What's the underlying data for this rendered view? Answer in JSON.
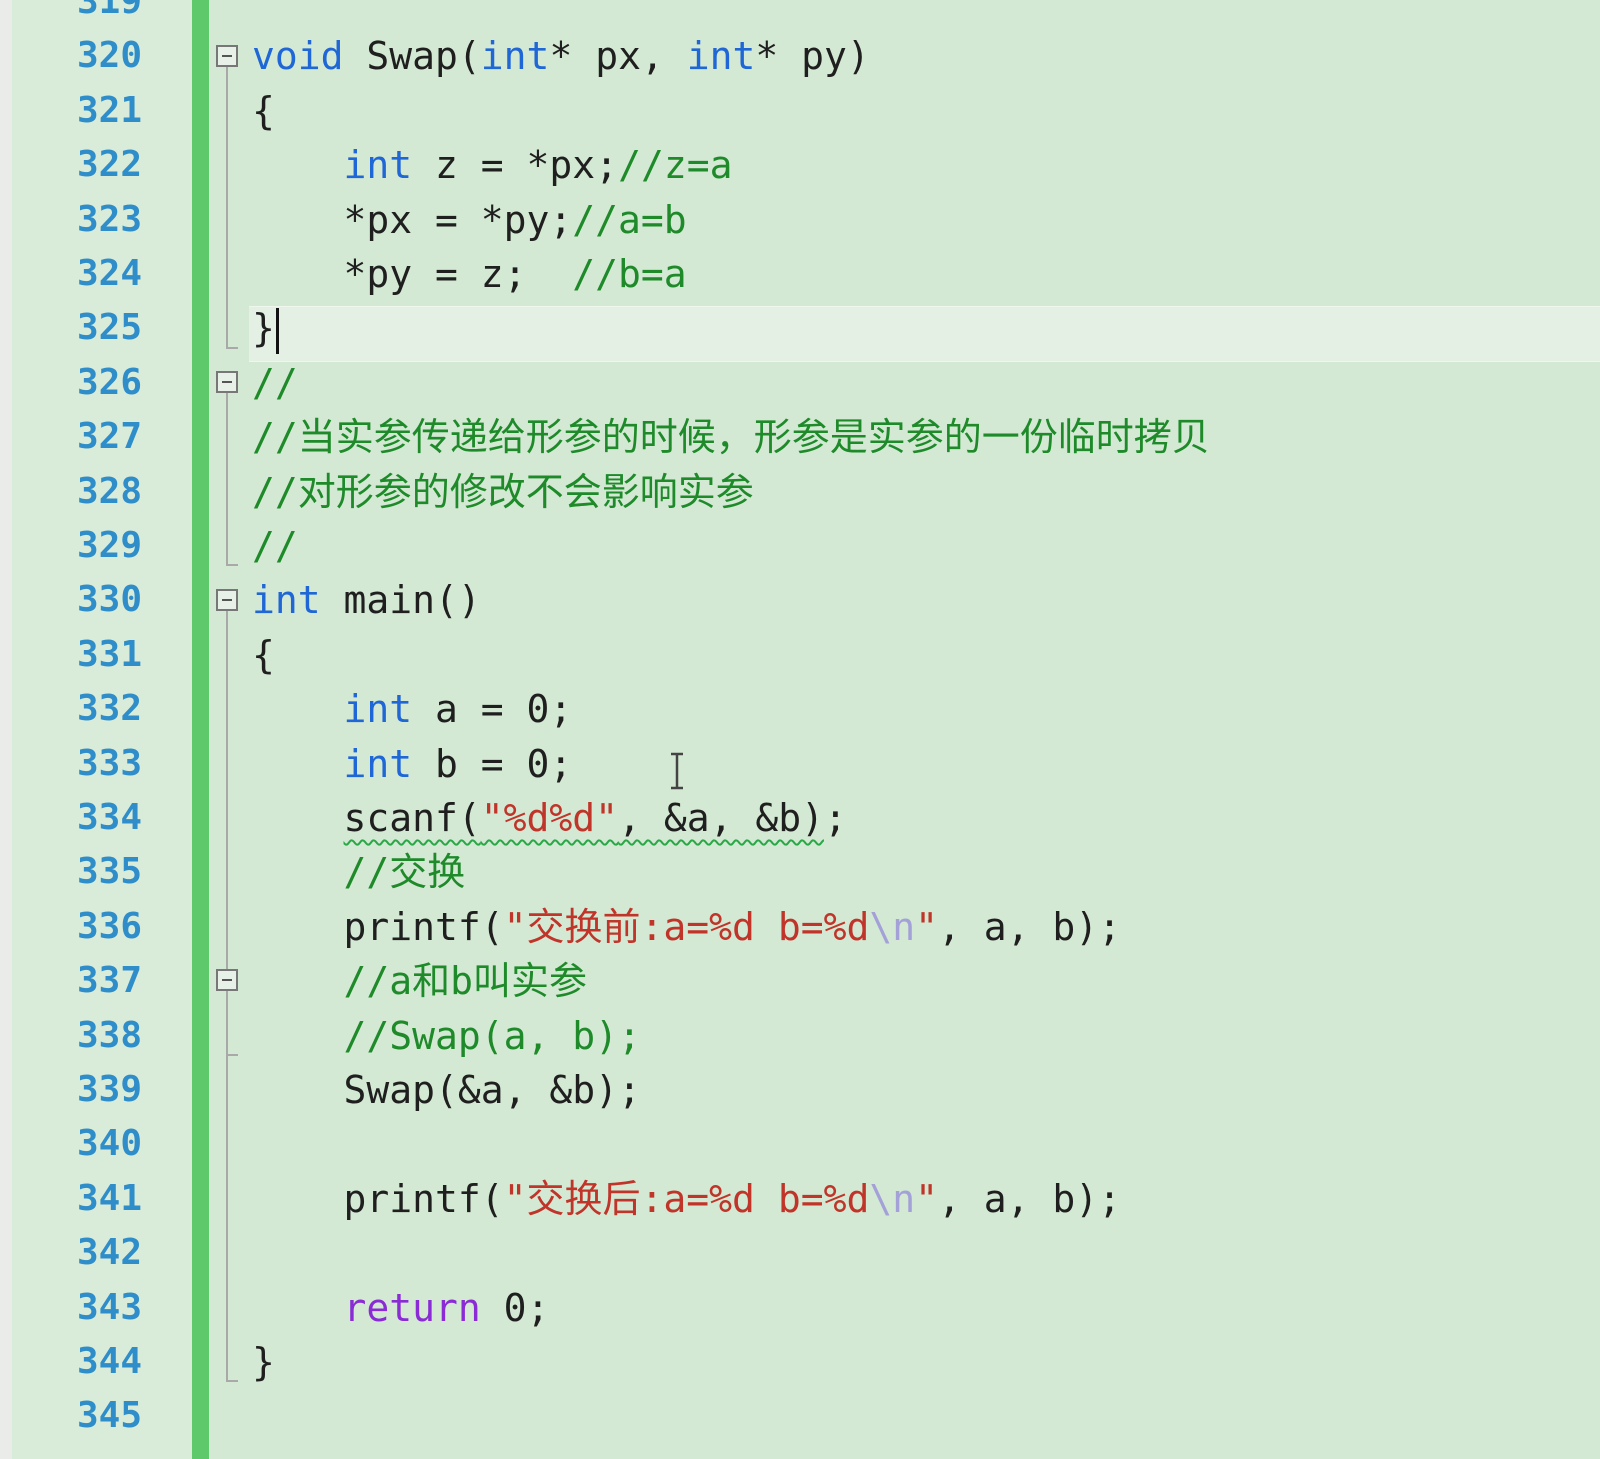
{
  "editor": {
    "current_line": 325,
    "lines": [
      {
        "n": "319",
        "segs": []
      },
      {
        "n": "320",
        "segs": [
          {
            "t": "void",
            "c": "kw"
          },
          {
            "t": " Swap(",
            "c": ""
          },
          {
            "t": "int",
            "c": "kw"
          },
          {
            "t": "* px, ",
            "c": ""
          },
          {
            "t": "int",
            "c": "kw"
          },
          {
            "t": "* py)",
            "c": ""
          }
        ]
      },
      {
        "n": "321",
        "segs": [
          {
            "t": "{",
            "c": ""
          }
        ]
      },
      {
        "n": "322",
        "segs": [
          {
            "t": "    ",
            "c": ""
          },
          {
            "t": "int",
            "c": "kw"
          },
          {
            "t": " z = *px;",
            "c": ""
          },
          {
            "t": "//z=a",
            "c": "cm"
          }
        ]
      },
      {
        "n": "323",
        "segs": [
          {
            "t": "    *px = *py;",
            "c": ""
          },
          {
            "t": "//a=b",
            "c": "cm"
          }
        ]
      },
      {
        "n": "324",
        "segs": [
          {
            "t": "    *py = z;  ",
            "c": ""
          },
          {
            "t": "//b=a",
            "c": "cm"
          }
        ]
      },
      {
        "n": "325",
        "segs": [
          {
            "t": "}",
            "c": ""
          }
        ],
        "caret": true
      },
      {
        "n": "326",
        "segs": [
          {
            "t": "//",
            "c": "cm"
          }
        ]
      },
      {
        "n": "327",
        "segs": [
          {
            "t": "//当实参传递给形参的时候，形参是实参的一份临时拷贝",
            "c": "cm"
          }
        ]
      },
      {
        "n": "328",
        "segs": [
          {
            "t": "//对形参的修改不会影响实参",
            "c": "cm"
          }
        ]
      },
      {
        "n": "329",
        "segs": [
          {
            "t": "//",
            "c": "cm"
          }
        ]
      },
      {
        "n": "330",
        "segs": [
          {
            "t": "int",
            "c": "kw"
          },
          {
            "t": " main()",
            "c": ""
          }
        ]
      },
      {
        "n": "331",
        "segs": [
          {
            "t": "{",
            "c": ""
          }
        ]
      },
      {
        "n": "332",
        "segs": [
          {
            "t": "    ",
            "c": ""
          },
          {
            "t": "int",
            "c": "kw"
          },
          {
            "t": " a = 0;",
            "c": ""
          }
        ]
      },
      {
        "n": "333",
        "segs": [
          {
            "t": "    ",
            "c": ""
          },
          {
            "t": "int",
            "c": "kw"
          },
          {
            "t": " b = 0;",
            "c": ""
          }
        ]
      },
      {
        "n": "334",
        "segs": [
          {
            "t": "    ",
            "c": ""
          },
          {
            "t": "scanf(",
            "c": "squiggle"
          },
          {
            "t": "\"%d%d\"",
            "c": "st squiggle"
          },
          {
            "t": ", &a, &b)",
            "c": "squiggle"
          },
          {
            "t": ";",
            "c": ""
          }
        ]
      },
      {
        "n": "335",
        "segs": [
          {
            "t": "    ",
            "c": ""
          },
          {
            "t": "//交换",
            "c": "cm"
          }
        ]
      },
      {
        "n": "336",
        "segs": [
          {
            "t": "    printf(",
            "c": ""
          },
          {
            "t": "\"交换前:a=%d b=%d",
            "c": "st"
          },
          {
            "t": "\\n",
            "c": "esc"
          },
          {
            "t": "\"",
            "c": "st"
          },
          {
            "t": ", a, b);",
            "c": ""
          }
        ]
      },
      {
        "n": "337",
        "segs": [
          {
            "t": "    ",
            "c": ""
          },
          {
            "t": "//a和b叫实参",
            "c": "cm"
          }
        ]
      },
      {
        "n": "338",
        "segs": [
          {
            "t": "    ",
            "c": ""
          },
          {
            "t": "//Swap(a, b);",
            "c": "cm"
          }
        ]
      },
      {
        "n": "339",
        "segs": [
          {
            "t": "    Swap(&a, &b);",
            "c": ""
          }
        ]
      },
      {
        "n": "340",
        "segs": []
      },
      {
        "n": "341",
        "segs": [
          {
            "t": "    printf(",
            "c": ""
          },
          {
            "t": "\"交换后:a=%d b=%d",
            "c": "st"
          },
          {
            "t": "\\n",
            "c": "esc"
          },
          {
            "t": "\"",
            "c": "st"
          },
          {
            "t": ", a, b);",
            "c": ""
          }
        ]
      },
      {
        "n": "342",
        "segs": []
      },
      {
        "n": "343",
        "segs": [
          {
            "t": "    ",
            "c": ""
          },
          {
            "t": "return",
            "c": "kw2"
          },
          {
            "t": " 0;",
            "c": ""
          }
        ]
      },
      {
        "n": "344",
        "segs": [
          {
            "t": "}",
            "c": ""
          }
        ]
      },
      {
        "n": "345",
        "segs": []
      }
    ]
  },
  "theme": {
    "background": "#d3e9d3",
    "line_number_color": "#2f8ec9",
    "change_bar_color": "#5ec96a",
    "keyword_color": "#1f66d6",
    "return_keyword_color": "#8a2bd6",
    "comment_color": "#1e8a2a",
    "string_color": "#c0342a",
    "escape_color": "#a4a0d8"
  },
  "icons": {
    "fold": "collapse-minus-icon",
    "cursor": "text-ibeam-cursor-icon"
  }
}
